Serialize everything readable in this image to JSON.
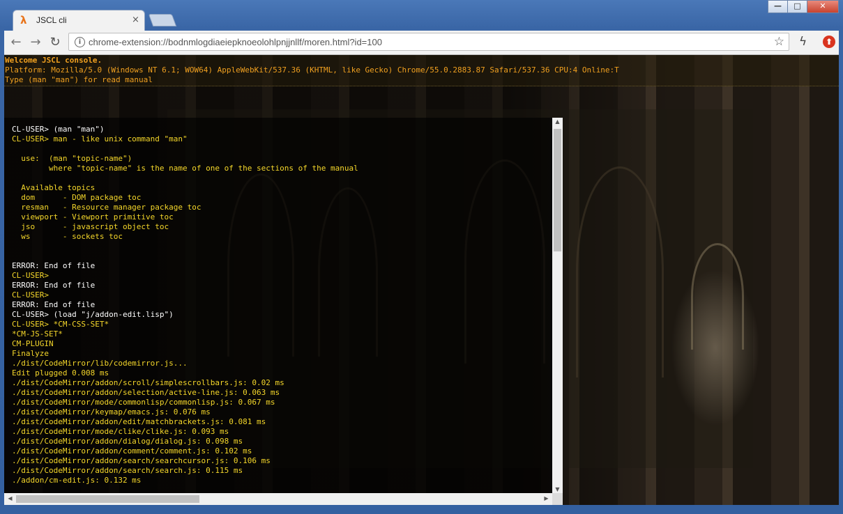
{
  "tab": {
    "title": "JSCL cli",
    "icon": "lambda-icon",
    "icon_glyph": "λ",
    "close": "×"
  },
  "window_controls": {
    "minimize": "—",
    "maximize": "□",
    "close": "✕"
  },
  "toolbar": {
    "back": "←",
    "forward": "→",
    "reload": "↻",
    "url": "chrome-extension://bodnmlogdiaeiepknoeolohlpnjjnllf/moren.html?id=100",
    "info": "i",
    "star": "☆",
    "ext1": "ϟ",
    "ext2": "⬆"
  },
  "header": {
    "lines": [
      "Welcome JSCL console.",
      "Platform: Mozilla/5.0 (Windows NT 6.1; WOW64) AppleWebKit/537.36 (KHTML, like Gecko) Chrome/55.0.2883.87 Safari/537.36 CPU:4 Online:T",
      "Type (man \"man\") for read manual"
    ]
  },
  "colors": {
    "white": "#ffffff",
    "yellow": "#f5d72a",
    "orange": "#f0a020"
  },
  "console": {
    "lines": [
      {
        "text": "CL-USER> (man \"man\")",
        "color": "#ffffff"
      },
      {
        "text": "CL-USER> man - like unix command \"man\"",
        "color": "#f5d72a"
      },
      {
        "text": "",
        "color": "#ffffff"
      },
      {
        "text": "  use:  (man \"topic-name\")",
        "color": "#f5d72a"
      },
      {
        "text": "        where \"topic-name\" is the name of one of the sections of the manual",
        "color": "#f5d72a"
      },
      {
        "text": "",
        "color": "#ffffff"
      },
      {
        "text": "  Available topics",
        "color": "#f5d72a"
      },
      {
        "text": "  dom      - DOM package toc",
        "color": "#f5d72a"
      },
      {
        "text": "  resman   - Resource manager package toc",
        "color": "#f5d72a"
      },
      {
        "text": "  viewport - Viewport primitive toc",
        "color": "#f5d72a"
      },
      {
        "text": "  jso      - javascript object toc",
        "color": "#f5d72a"
      },
      {
        "text": "  ws       - sockets toc",
        "color": "#f5d72a"
      },
      {
        "text": "",
        "color": "#ffffff"
      },
      {
        "text": "",
        "color": "#ffffff"
      },
      {
        "text": "ERROR: End of file",
        "color": "#ffffff"
      },
      {
        "text": "CL-USER>",
        "color": "#f5d72a"
      },
      {
        "text": "ERROR: End of file",
        "color": "#ffffff"
      },
      {
        "text": "CL-USER>",
        "color": "#f5d72a"
      },
      {
        "text": "ERROR: End of file",
        "color": "#ffffff"
      },
      {
        "text": "CL-USER> (load \"j/addon-edit.lisp\")",
        "color": "#ffffff"
      },
      {
        "text": "CL-USER> *CM-CSS-SET*",
        "color": "#f5d72a"
      },
      {
        "text": "*CM-JS-SET*",
        "color": "#f5d72a"
      },
      {
        "text": "CM-PLUGIN",
        "color": "#f5d72a"
      },
      {
        "text": "Finalyze",
        "color": "#f5d72a"
      },
      {
        "text": "./dist/CodeMirror/lib/codemirror.js...",
        "color": "#f5d72a"
      },
      {
        "text": "Edit plugged 0.008 ms",
        "color": "#f5d72a"
      },
      {
        "text": "./dist/CodeMirror/addon/scroll/simplescrollbars.js: 0.02 ms",
        "color": "#f5d72a"
      },
      {
        "text": "./dist/CodeMirror/addon/selection/active-line.js: 0.063 ms",
        "color": "#f5d72a"
      },
      {
        "text": "./dist/CodeMirror/mode/commonlisp/commonlisp.js: 0.067 ms",
        "color": "#f5d72a"
      },
      {
        "text": "./dist/CodeMirror/keymap/emacs.js: 0.076 ms",
        "color": "#f5d72a"
      },
      {
        "text": "./dist/CodeMirror/addon/edit/matchbrackets.js: 0.081 ms",
        "color": "#f5d72a"
      },
      {
        "text": "./dist/CodeMirror/mode/clike/clike.js: 0.093 ms",
        "color": "#f5d72a"
      },
      {
        "text": "./dist/CodeMirror/addon/dialog/dialog.js: 0.098 ms",
        "color": "#f5d72a"
      },
      {
        "text": "./dist/CodeMirror/addon/comment/comment.js: 0.102 ms",
        "color": "#f5d72a"
      },
      {
        "text": "./dist/CodeMirror/addon/search/searchcursor.js: 0.106 ms",
        "color": "#f5d72a"
      },
      {
        "text": "./dist/CodeMirror/addon/search/search.js: 0.115 ms",
        "color": "#f5d72a"
      },
      {
        "text": "./addon/cm-edit.js: 0.132 ms",
        "color": "#f5d72a"
      }
    ]
  },
  "scrollbars": {
    "up": "▲",
    "down": "▼",
    "left": "◀",
    "right": "▶"
  }
}
